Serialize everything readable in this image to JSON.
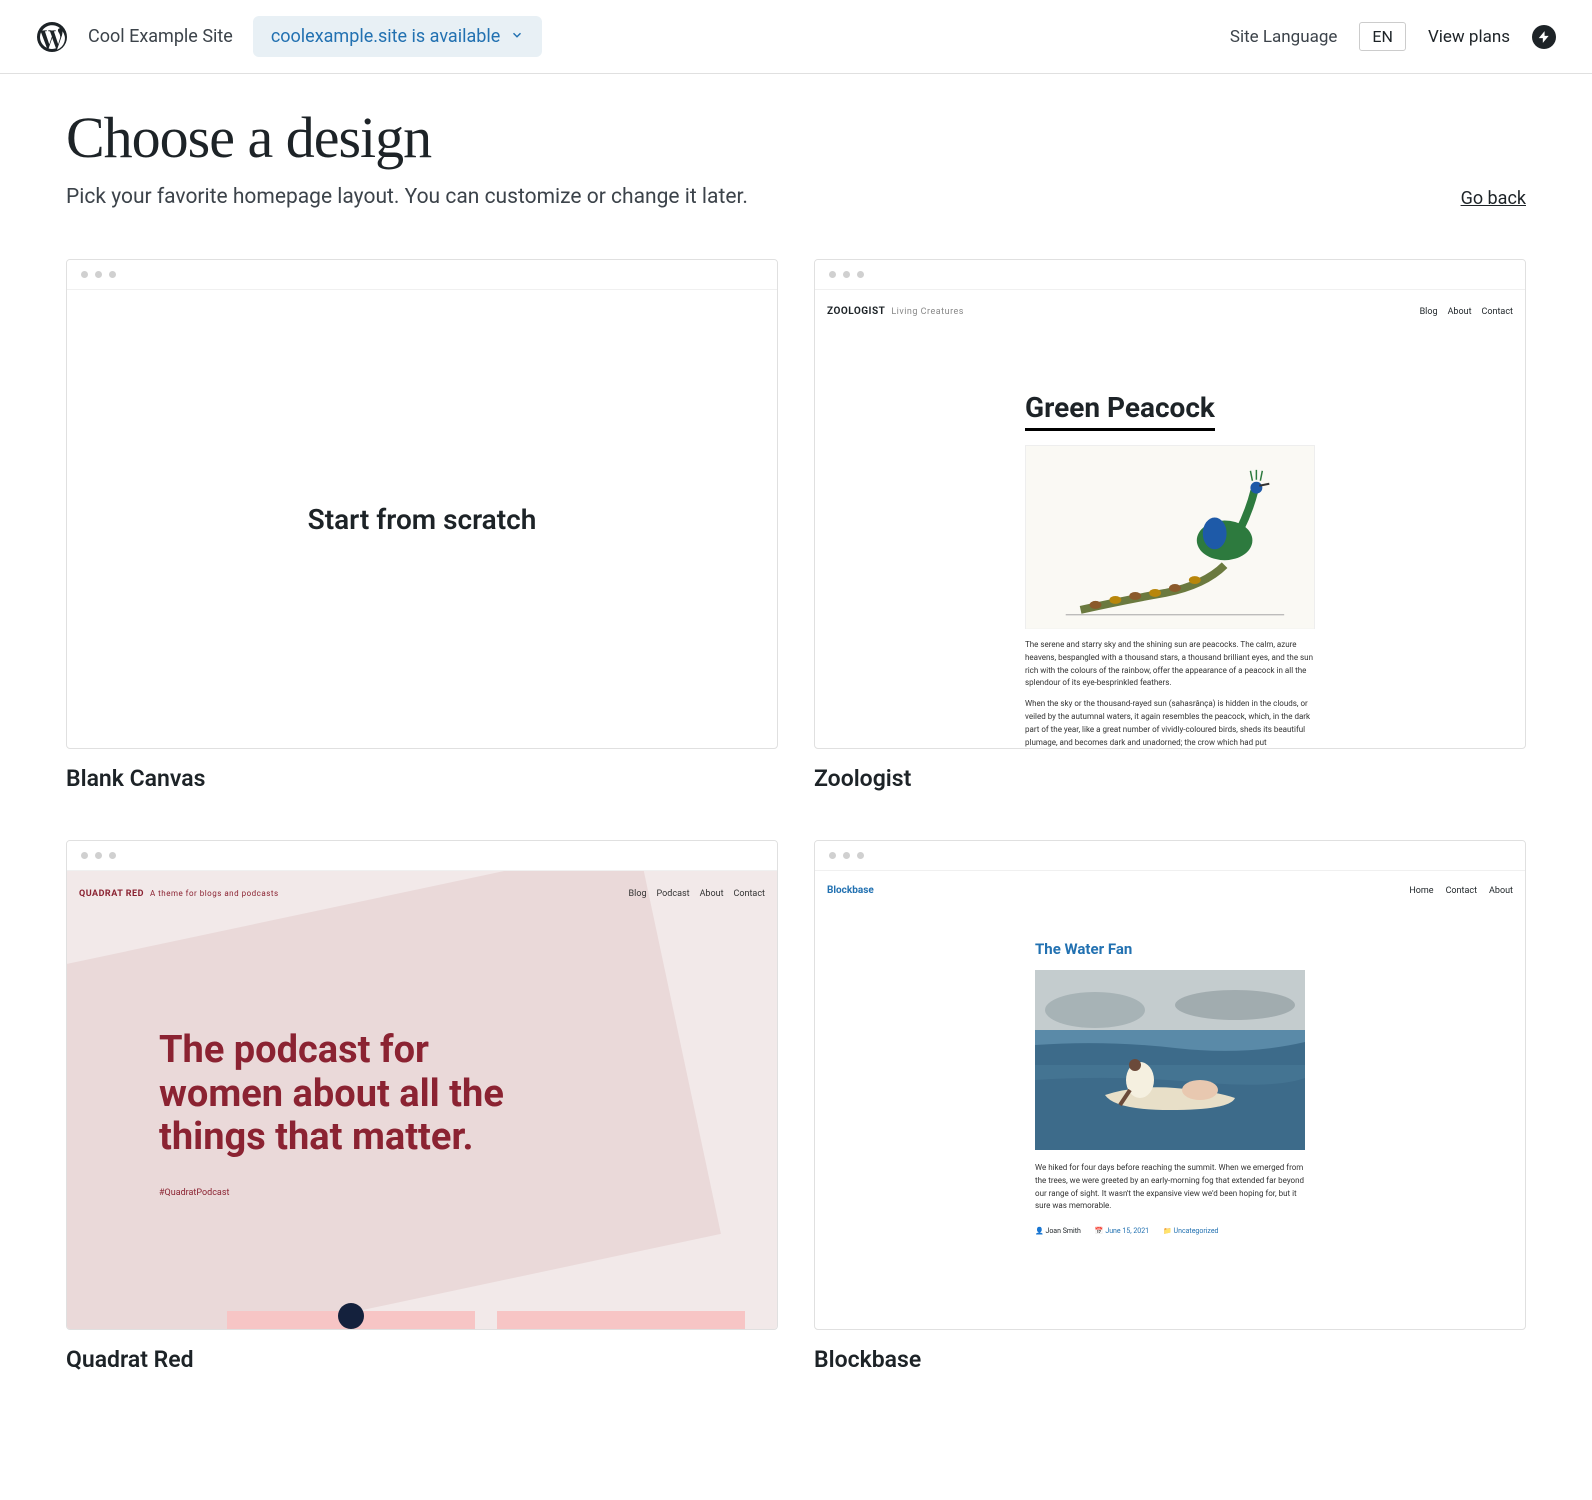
{
  "header": {
    "site_name": "Cool Example Site",
    "domain_status": "coolexample.site is available",
    "lang_label": "Site Language",
    "lang_value": "EN",
    "view_plans": "View plans"
  },
  "page": {
    "title": "Choose a design",
    "subtitle": "Pick your favorite homepage layout. You can customize or change it later.",
    "go_back": "Go back"
  },
  "themes": [
    {
      "name": "Blank Canvas",
      "preview": {
        "scratch_text": "Start from scratch"
      }
    },
    {
      "name": "Zoologist",
      "preview": {
        "brand": "ZOOLOGIST",
        "tagline": "Living Creatures",
        "nav": [
          "Blog",
          "About",
          "Contact"
        ],
        "article_title": "Green Peacock",
        "para1": "The serene and starry sky and the shining sun are peacocks. The calm, azure heavens, bespangled with a thousand stars, a thousand brilliant eyes, and the sun rich with the colours of the rainbow, offer the appearance of a peacock in all the splendour of its eye-besprinkled feathers.",
        "para2": "When the sky or the thousand-rayed sun (sahasrânça) is hidden in the clouds, or veiled by the autumnal waters, it again resembles the peacock, which, in the dark part of the year, like a great number of vividly-coloured birds, sheds its beautiful plumage, and becomes dark and unadorned; the crow which had put"
      }
    },
    {
      "name": "Quadrat Red",
      "preview": {
        "brand": "QUADRAT RED",
        "tagline": "A theme for blogs and podcasts",
        "nav": [
          "Blog",
          "Podcast",
          "About",
          "Contact"
        ],
        "hero": "The podcast for women about all the things that matter.",
        "hashtag": "#QuadratPodcast"
      }
    },
    {
      "name": "Blockbase",
      "preview": {
        "brand": "Blockbase",
        "nav": [
          "Home",
          "Contact",
          "About"
        ],
        "article_title": "The Water Fan",
        "para": "We hiked for four days before reaching the summit. When we emerged from the trees, we were greeted by an early-morning fog that extended far beyond our range of sight. It wasn't the expansive view we'd been hoping for, but it sure was memorable.",
        "meta_author": "Joan Smith",
        "meta_date": "June 15, 2021",
        "meta_cat": "Uncategorized"
      }
    }
  ]
}
